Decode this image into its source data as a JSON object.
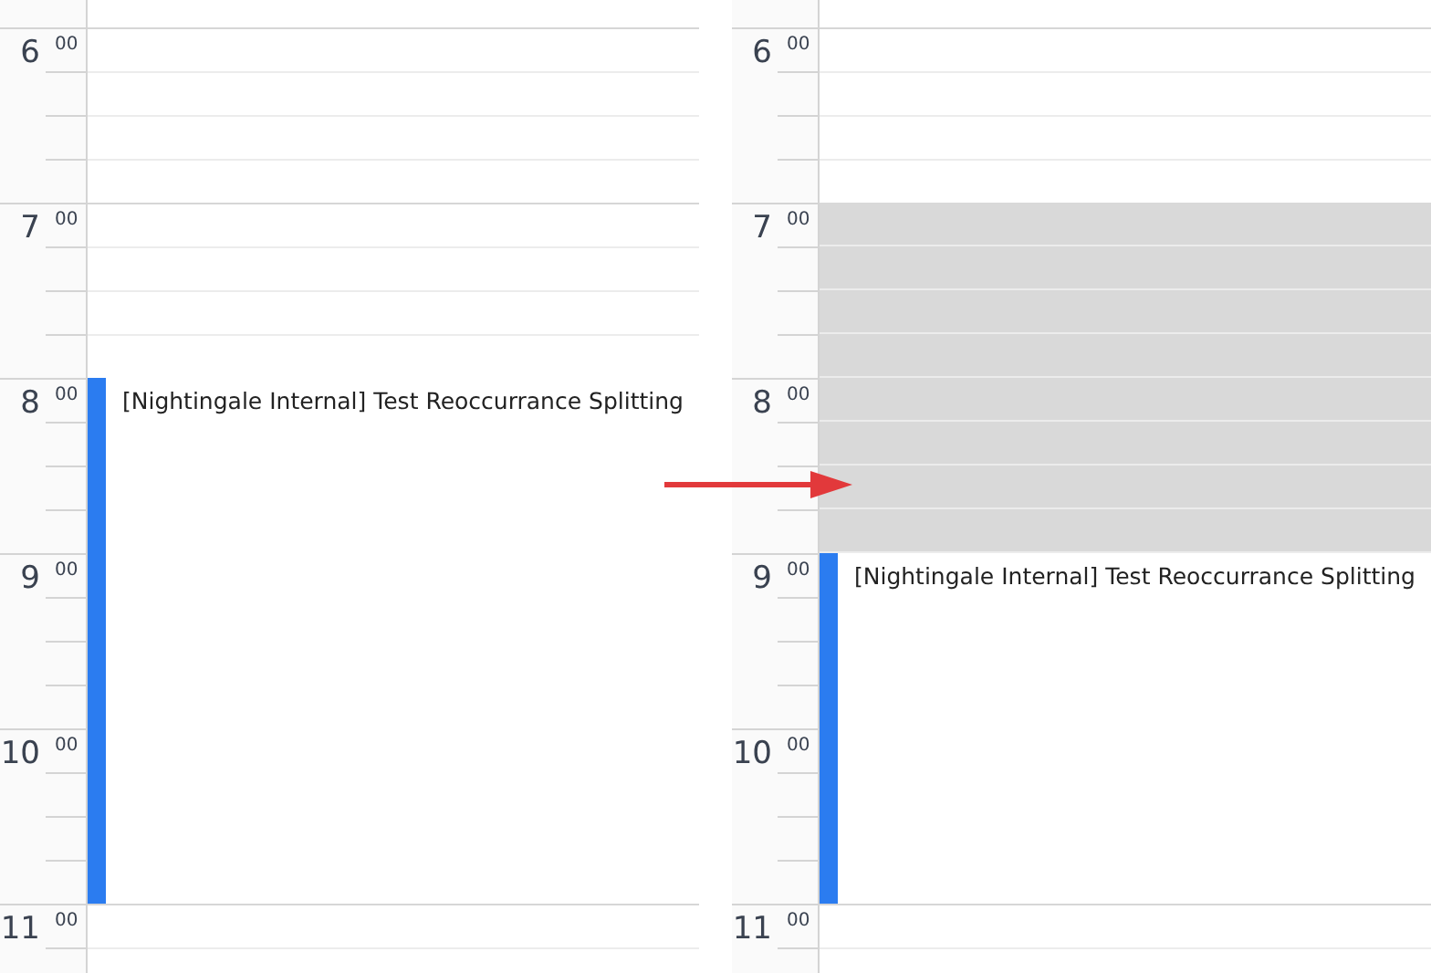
{
  "panels": [
    {
      "hours": [
        {
          "hour": "6",
          "minutes": "00",
          "busy": false,
          "in_event": false
        },
        {
          "hour": "7",
          "minutes": "00",
          "busy": false,
          "in_event": false
        },
        {
          "hour": "8",
          "minutes": "00",
          "busy": false,
          "in_event": true,
          "event_title": "[Nightingale Internal] Test Reoccurrance Splitting"
        },
        {
          "hour": "9",
          "minutes": "00",
          "busy": false,
          "in_event": true
        },
        {
          "hour": "10",
          "minutes": "00",
          "busy": false,
          "in_event": true
        },
        {
          "hour": "11",
          "minutes": "00",
          "busy": false,
          "in_event": false
        }
      ]
    },
    {
      "hours": [
        {
          "hour": "6",
          "minutes": "00",
          "busy": false,
          "in_event": false
        },
        {
          "hour": "7",
          "minutes": "00",
          "busy": true,
          "in_event": false
        },
        {
          "hour": "8",
          "minutes": "00",
          "busy": true,
          "in_event": false
        },
        {
          "hour": "9",
          "minutes": "00",
          "busy": false,
          "in_event": true,
          "event_title": "[Nightingale Internal] Test Reoccurrance Splitting"
        },
        {
          "hour": "10",
          "minutes": "00",
          "busy": false,
          "in_event": true
        },
        {
          "hour": "11",
          "minutes": "00",
          "busy": false,
          "in_event": false
        }
      ]
    }
  ]
}
